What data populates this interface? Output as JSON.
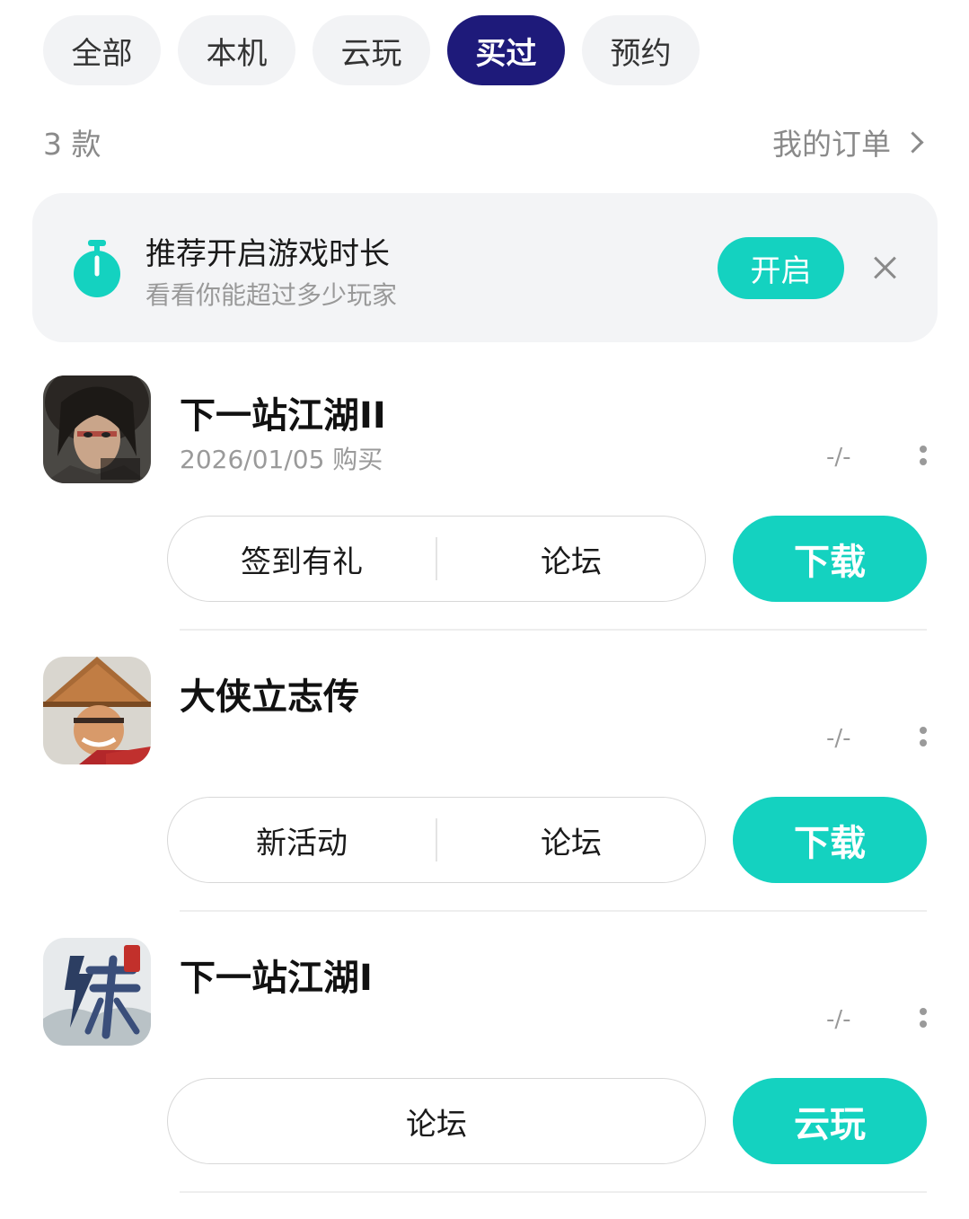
{
  "tabs": [
    {
      "label": "全部",
      "active": false
    },
    {
      "label": "本机",
      "active": false
    },
    {
      "label": "云玩",
      "active": false
    },
    {
      "label": "买过",
      "active": true
    },
    {
      "label": "预约",
      "active": false
    }
  ],
  "summary": {
    "count_text": "3 款",
    "orders_link": "我的订单"
  },
  "banner": {
    "icon": "stopwatch-icon",
    "title": "推荐开启游戏时长",
    "subtitle": "看看你能超过多少玩家",
    "button_label": "开启",
    "close_icon": "close-icon"
  },
  "games": [
    {
      "name": "下一站江湖II",
      "date": "2026/01/05 购买",
      "stat": "-/-",
      "links": [
        "签到有礼",
        "论坛"
      ],
      "action_label": "下载"
    },
    {
      "name": "大侠立志传",
      "date": "",
      "stat": "-/-",
      "links": [
        "新活动",
        "论坛"
      ],
      "action_label": "下载"
    },
    {
      "name": "下一站江湖I",
      "date": "",
      "stat": "-/-",
      "links": [
        "论坛"
      ],
      "action_label": "云玩"
    }
  ],
  "colors": {
    "accent": "#14d2c0",
    "active_tab": "#1e1a7a",
    "muted": "#8a8a8a"
  }
}
